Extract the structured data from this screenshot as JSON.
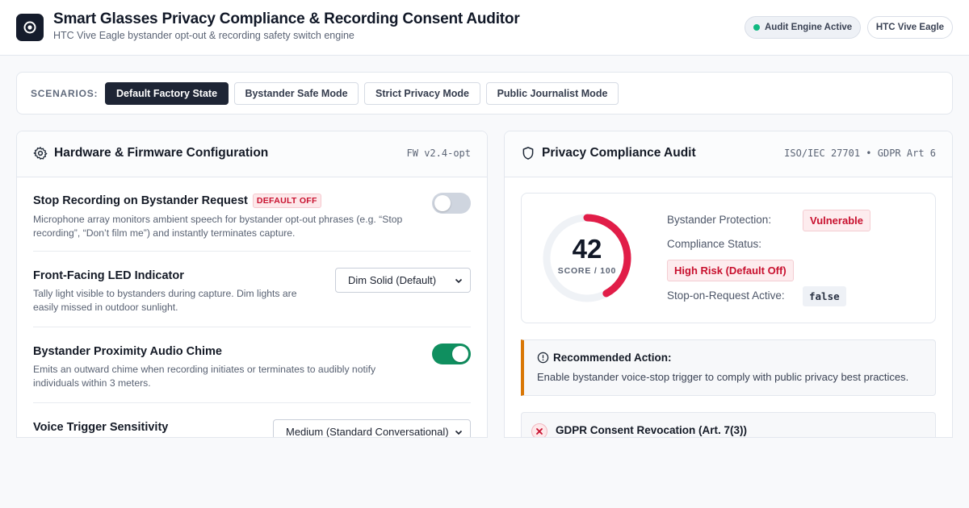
{
  "header": {
    "title": "Smart Glasses Privacy Compliance & Recording Consent Auditor",
    "subtitle": "HTC Vive Eagle bystander opt-out & recording safety switch engine",
    "status_pill": "Audit Engine Active",
    "device_pill": "HTC Vive Eagle",
    "status_color": "#10b981"
  },
  "scenarios": {
    "label": "SCENARIOS:",
    "buttons": [
      {
        "label": "Default Factory State",
        "active": true
      },
      {
        "label": "Bystander Safe Mode",
        "active": false
      },
      {
        "label": "Strict Privacy Mode",
        "active": false
      },
      {
        "label": "Public Journalist Mode",
        "active": false
      }
    ]
  },
  "config_panel": {
    "title": "Hardware & Firmware Configuration",
    "firmware": "FW v2.4-opt",
    "settings": [
      {
        "title": "Stop Recording on Bystander Request",
        "badge": "DEFAULT OFF",
        "description": "Microphone array monitors ambient speech for bystander opt-out phrases (e.g. “Stop recording”, “Don’t film me”) and instantly terminates capture.",
        "toggle": false
      },
      {
        "title": "Front-Facing LED Indicator",
        "description": "Tally light visible to bystanders during capture. Dim lights are easily missed in outdoor sunlight.",
        "select_value": "Dim Solid (Default)"
      },
      {
        "title": "Bystander Proximity Audio Chime",
        "description": "Emits an outward chime when recording initiates or terminates to audibly notify individuals within 3 meters.",
        "toggle": true
      },
      {
        "title": "Voice Trigger Sensitivity",
        "select_value": "Medium (Standard Conversational)"
      }
    ]
  },
  "audit_panel": {
    "title": "Privacy Compliance Audit",
    "standards": "ISO/IEC 27701 • GDPR Art 6",
    "score": {
      "value": "42",
      "label": "SCORE / 100",
      "max": 100,
      "color": "#e11d48"
    },
    "bystander_protection_label": "Bystander Protection:",
    "bystander_protection_value": "Vulnerable",
    "compliance_status_label": "Compliance Status:",
    "compliance_status_value": "High Risk (Default Off)",
    "stop_on_request_label": "Stop-on-Request Active:",
    "stop_on_request_value": "false",
    "recommendation": {
      "title": "Recommended Action:",
      "text": "Enable bystander voice-stop trigger to comply with public privacy best practices.",
      "accent": "#d97706"
    },
    "checks": [
      {
        "title": "GDPR Consent Revocation (Art. 7(3))",
        "passed": false
      }
    ]
  }
}
